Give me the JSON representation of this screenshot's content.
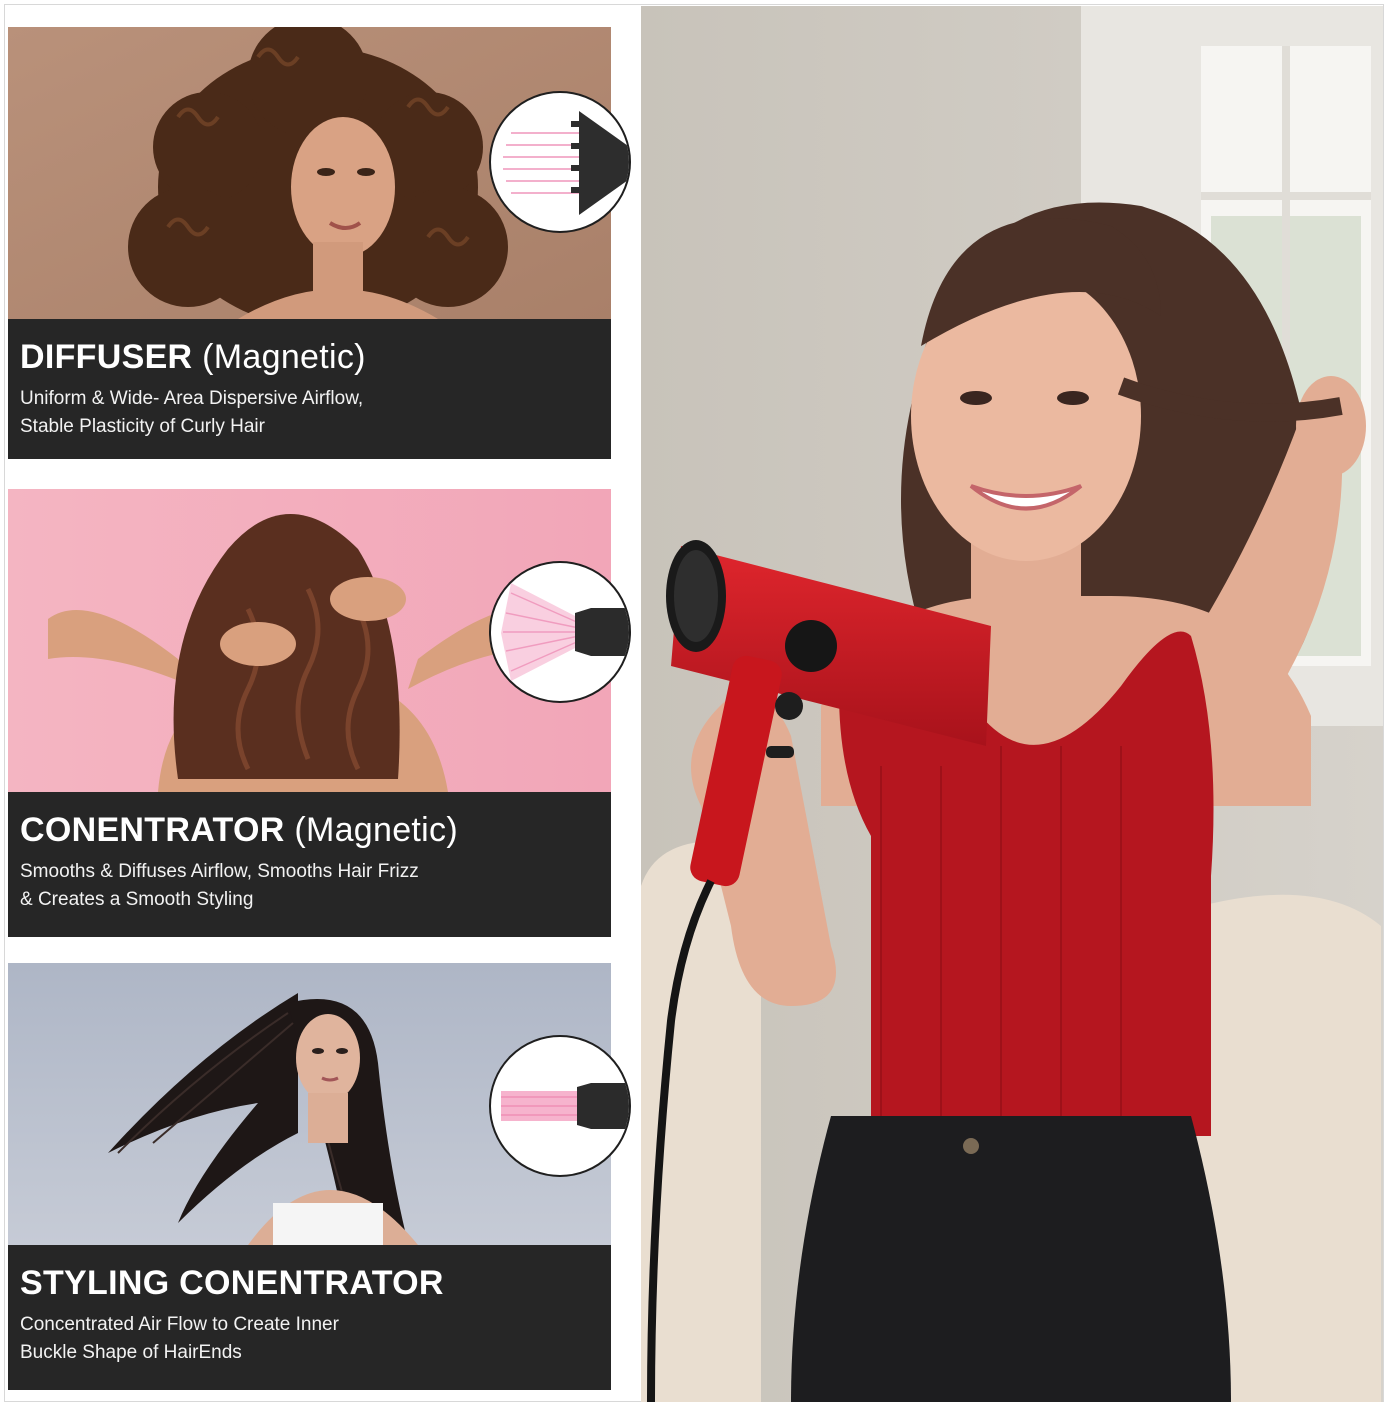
{
  "colors": {
    "caption_bg": "#262626",
    "caption_text": "#ffffff",
    "dryer_red": "#c8161d",
    "tank_top_red": "#a8121b",
    "airflow_pink": "#f4a6c4"
  },
  "cards": [
    {
      "title": "DIFFUSER",
      "title_suffix": "(Magnetic)",
      "desc_line1": "Uniform & Wide- Area Dispersive Airflow,",
      "desc_line2": "Stable Plasticity of Curly Hair",
      "icon": "diffuser-attachment-icon"
    },
    {
      "title": "CONENTRATOR",
      "title_suffix": "(Magnetic)",
      "desc_line1": "Smooths & Diffuses Airflow, Smooths Hair Frizz",
      "desc_line2": "& Creates  a Smooth Styling",
      "icon": "concentrator-attachment-icon"
    },
    {
      "title": "STYLING CONENTRATOR",
      "title_suffix": "",
      "desc_line1": "Concentrated Air Flow to Create Inner",
      "desc_line2": "Buckle Shape of HairEnds",
      "icon": "styling-concentrator-attachment-icon"
    }
  ]
}
